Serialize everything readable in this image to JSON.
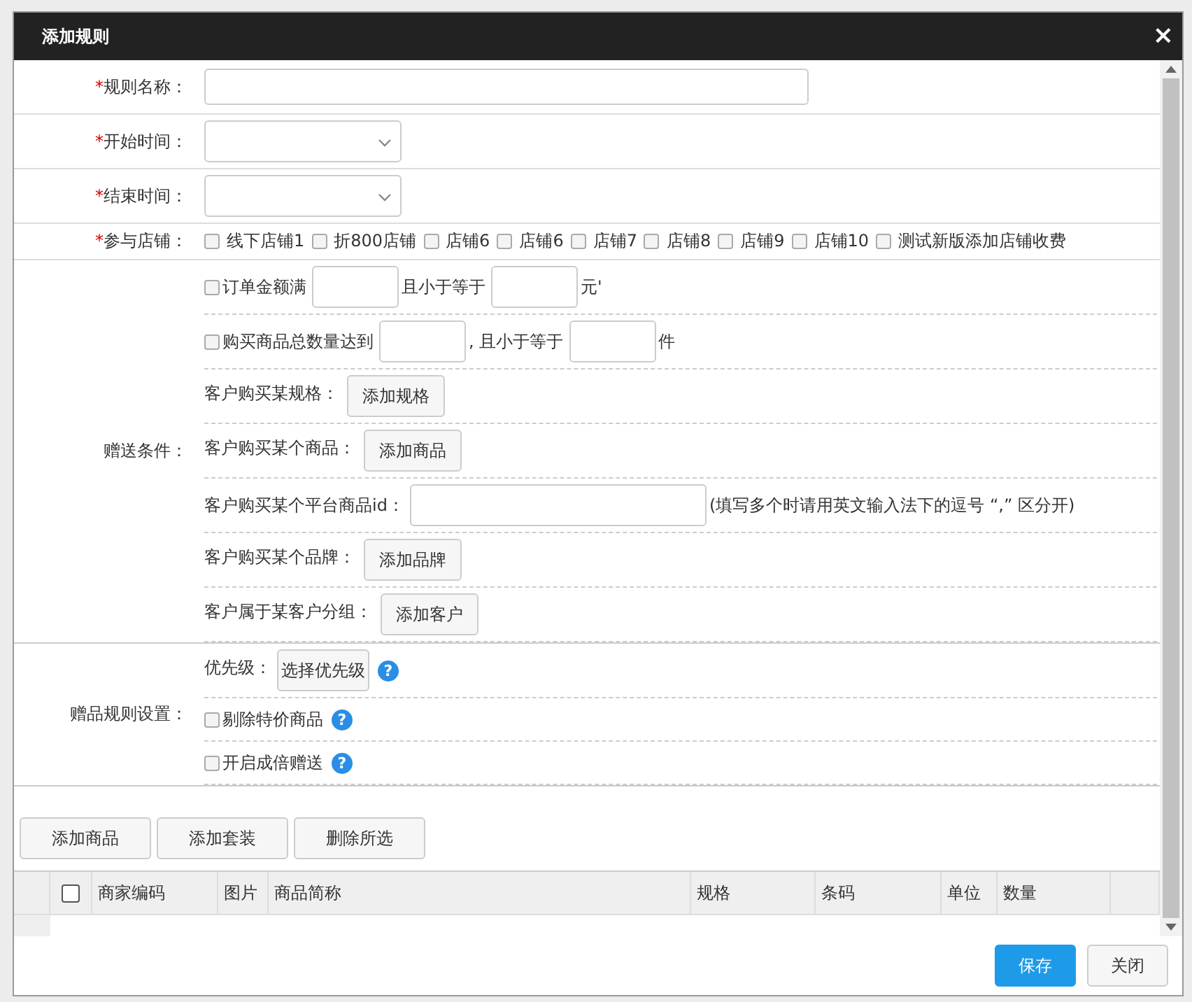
{
  "dialog": {
    "title": "添加规则",
    "close": "×"
  },
  "fields": [
    {
      "kind": "text",
      "label": "规则名称：",
      "mark": "*"
    },
    {
      "kind": "select",
      "label": "开始时间：",
      "mark": "*"
    },
    {
      "kind": "select",
      "label": "结束时间：",
      "mark": "*"
    }
  ],
  "stores": {
    "label": "参与店铺：",
    "mark": "*",
    "options": [
      {
        "label": "线下店铺1",
        "checked": false
      },
      {
        "label": "折800店铺",
        "checked": false
      },
      {
        "label": "店铺6",
        "checked": false
      },
      {
        "label": "店铺6",
        "checked": false
      },
      {
        "label": "店铺7",
        "checked": false
      },
      {
        "label": "店铺8",
        "checked": false
      },
      {
        "label": "店铺9",
        "checked": false
      },
      {
        "label": "店铺10",
        "checked": false
      },
      {
        "label": "测试新版添加店铺收费",
        "checked": false
      }
    ]
  },
  "conditions": {
    "label": "赠送条件：",
    "rows": [
      {
        "kind": "range",
        "checked": false,
        "label": "订单金额满",
        "middle": "且小于等于",
        "unit": "元'"
      },
      {
        "kind": "range",
        "checked": false,
        "label": "购买商品总数量达到",
        "middle": ", 且小于等于",
        "unit": "件"
      },
      {
        "kind": "button",
        "label": "客户购买某规格：",
        "button": "添加规格"
      },
      {
        "kind": "button",
        "label": "客户购买某个商品：",
        "button": "添加商品"
      },
      {
        "kind": "input",
        "label": "客户购买某个平台商品id：",
        "hint": "(填写多个时请用英文输入法下的逗号 “,” 区分开)"
      },
      {
        "kind": "button",
        "label": "客户购买某个品牌：",
        "button": "添加品牌"
      },
      {
        "kind": "button",
        "label": "客户属于某客户分组：",
        "button": "添加客户"
      }
    ]
  },
  "settings": {
    "label": "赠品规则设置：",
    "rows": [
      {
        "kind": "button",
        "label": "优先级：",
        "button": "选择优先级",
        "help": "?"
      },
      {
        "kind": "check",
        "checked": false,
        "label": "剔除特价商品",
        "help": "?"
      },
      {
        "kind": "check",
        "checked": false,
        "label": "开启成倍赠送",
        "help": "?"
      }
    ]
  },
  "toolbar": [
    "添加商品",
    "添加套装",
    "删除所选"
  ],
  "table": {
    "checked": false,
    "columns": [
      "商家编码",
      "图片",
      "商品简称",
      "规格",
      "条码",
      "单位",
      "数量"
    ]
  },
  "footer": [
    {
      "kind": "primary",
      "label": "保存"
    },
    {
      "kind": "default",
      "label": "关闭"
    }
  ]
}
